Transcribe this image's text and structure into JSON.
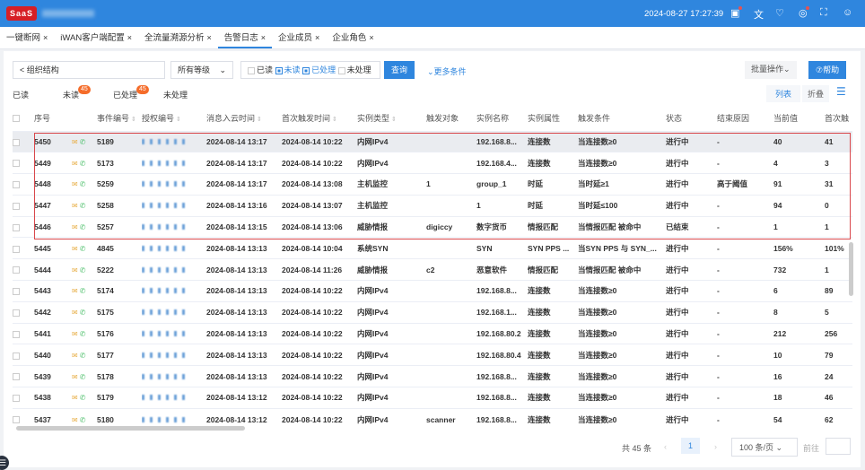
{
  "header": {
    "logo": "SaaS",
    "datetime": "2024-08-27 17:27:39",
    "icons": [
      "calendar-icon",
      "translate-icon",
      "shirt-icon",
      "bell-icon",
      "fullscreen-icon",
      "user-icon"
    ]
  },
  "tabs": [
    {
      "label": "一键断网"
    },
    {
      "label": "iWAN客户端配置"
    },
    {
      "label": "全流量溯源分析"
    },
    {
      "label": "告警日志",
      "active": true
    },
    {
      "label": "企业成员"
    },
    {
      "label": "企业角色"
    }
  ],
  "filters": {
    "org": "< 组织结构",
    "level": "所有等级",
    "read": "已读",
    "unread": "未读",
    "processed": "已处理",
    "unprocessed": "未处理",
    "query": "查询",
    "more": "⌄更多条件",
    "batch": "批量操作⌄",
    "help": "⑦帮助"
  },
  "status_tabs": {
    "read": "已读",
    "unread": "未读",
    "unread_count": "45",
    "processed": "已处理",
    "processed_count": "45",
    "unprocessed": "未处理"
  },
  "view": {
    "list": "列表",
    "fold": "折叠"
  },
  "columns": [
    "序号",
    "事件编号",
    "授权编号",
    "消息入云时间",
    "首次触发时间",
    "实例类型",
    "触发对象",
    "实例名称",
    "实例属性",
    "触发条件",
    "状态",
    "结束原因",
    "当前值",
    "首次触"
  ],
  "rows": [
    [
      "5450",
      "5189",
      "2024-08-14 13:17",
      "2024-08-14 10:22",
      "内网IPv4",
      "",
      "192.168.8...",
      "连接数",
      "当连接数≥0",
      "进行中",
      "-",
      "40",
      "41"
    ],
    [
      "5449",
      "5173",
      "2024-08-14 13:17",
      "2024-08-14 10:22",
      "内网IPv4",
      "",
      "192.168.4...",
      "连接数",
      "当连接数≥0",
      "进行中",
      "-",
      "4",
      "3"
    ],
    [
      "5448",
      "5259",
      "2024-08-14 13:17",
      "2024-08-14 13:08",
      "主机监控",
      "1",
      "group_1",
      "时延",
      "当时延≥1",
      "进行中",
      "高于阈值",
      "91",
      "31"
    ],
    [
      "5447",
      "5258",
      "2024-08-14 13:16",
      "2024-08-14 13:07",
      "主机监控",
      "",
      "1",
      "时延",
      "当时延≤100",
      "进行中",
      "-",
      "94",
      "0"
    ],
    [
      "5446",
      "5257",
      "2024-08-14 13:15",
      "2024-08-14 13:06",
      "威胁情报",
      "digiccy",
      "数字货币",
      "情报匹配",
      "当情报匹配 被命中",
      "已结束",
      "-",
      "1",
      "1"
    ],
    [
      "5445",
      "4845",
      "2024-08-14 13:13",
      "2024-08-14 10:04",
      "系统SYN",
      "",
      "SYN",
      "SYN PPS ...",
      "当SYN PPS 与 SYN_...",
      "进行中",
      "-",
      "156%",
      "101%"
    ],
    [
      "5444",
      "5222",
      "2024-08-14 13:13",
      "2024-08-14 11:26",
      "威胁情报",
      "c2",
      "恶意软件",
      "情报匹配",
      "当情报匹配 被命中",
      "进行中",
      "-",
      "732",
      "1"
    ],
    [
      "5443",
      "5174",
      "2024-08-14 13:13",
      "2024-08-14 10:22",
      "内网IPv4",
      "",
      "192.168.8...",
      "连接数",
      "当连接数≥0",
      "进行中",
      "-",
      "6",
      "89"
    ],
    [
      "5442",
      "5175",
      "2024-08-14 13:13",
      "2024-08-14 10:22",
      "内网IPv4",
      "",
      "192.168.1...",
      "连接数",
      "当连接数≥0",
      "进行中",
      "-",
      "8",
      "5"
    ],
    [
      "5441",
      "5176",
      "2024-08-14 13:13",
      "2024-08-14 10:22",
      "内网IPv4",
      "",
      "192.168.80.2",
      "连接数",
      "当连接数≥0",
      "进行中",
      "-",
      "212",
      "256"
    ],
    [
      "5440",
      "5177",
      "2024-08-14 13:13",
      "2024-08-14 10:22",
      "内网IPv4",
      "",
      "192.168.80.4",
      "连接数",
      "当连接数≥0",
      "进行中",
      "-",
      "10",
      "79"
    ],
    [
      "5439",
      "5178",
      "2024-08-14 13:13",
      "2024-08-14 10:22",
      "内网IPv4",
      "",
      "192.168.8...",
      "连接数",
      "当连接数≥0",
      "进行中",
      "-",
      "16",
      "24"
    ],
    [
      "5438",
      "5179",
      "2024-08-14 13:12",
      "2024-08-14 10:22",
      "内网IPv4",
      "",
      "192.168.8...",
      "连接数",
      "当连接数≥0",
      "进行中",
      "-",
      "18",
      "46"
    ],
    [
      "5437",
      "5180",
      "2024-08-14 13:12",
      "2024-08-14 10:22",
      "内网IPv4",
      "scanner",
      "192.168.8...",
      "连接数",
      "当连接数≥0",
      "进行中",
      "-",
      "54",
      "62"
    ]
  ],
  "pagination": {
    "total": "共 45 条",
    "page": "1",
    "size": "100 条/页",
    "goto": "前往"
  },
  "colors": {
    "brand": "#2f86de",
    "highlight": "#d9474b"
  }
}
